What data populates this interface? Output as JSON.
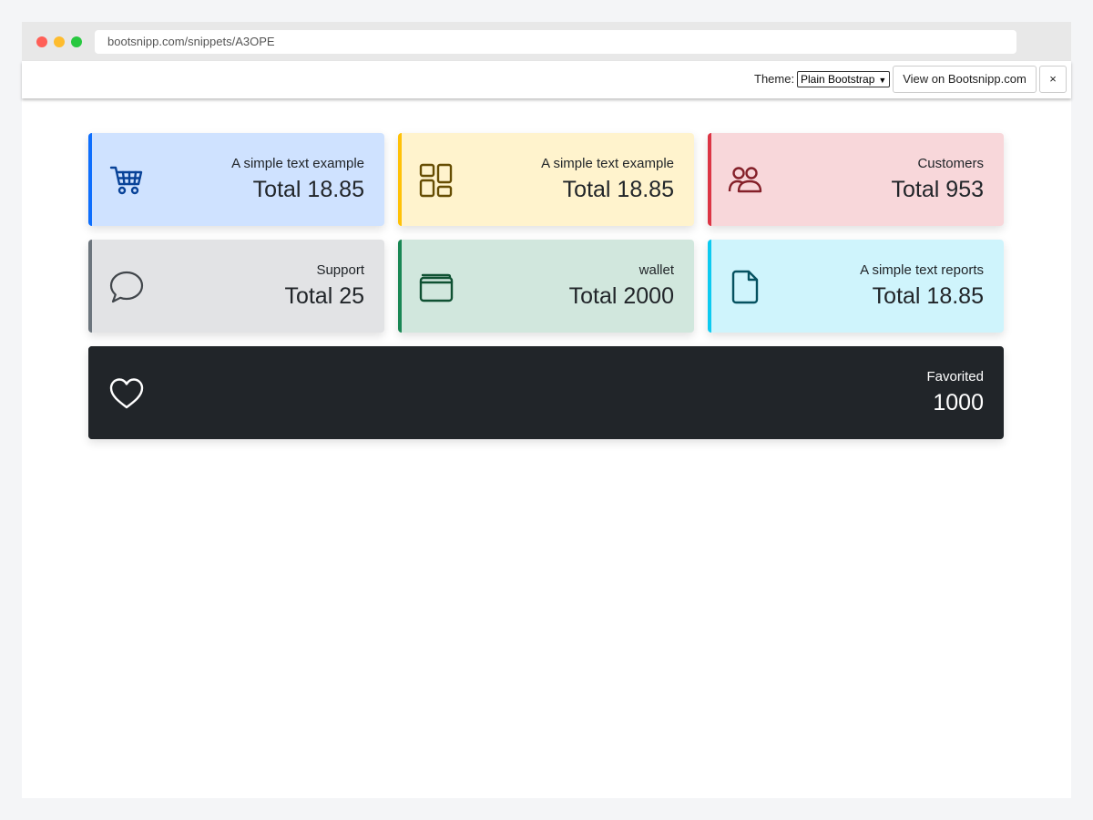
{
  "browser": {
    "url": "bootsnipp.com/snippets/A3OPE"
  },
  "toolbar": {
    "theme_label": "Theme:",
    "theme_selected": "Plain Bootstrap",
    "view_button": "View on Bootsnipp.com",
    "close_button": "×"
  },
  "cards": [
    {
      "label": "A simple text example",
      "value": "Total 18.85",
      "icon": "cart-icon",
      "bg": "#cfe2ff",
      "accent": "#0d6efd",
      "icon_color": "#084298"
    },
    {
      "label": "A simple text example",
      "value": "Total 18.85",
      "icon": "dashboard-icon",
      "bg": "#fff3cd",
      "accent": "#ffc107",
      "icon_color": "#664d03"
    },
    {
      "label": "Customers",
      "value": "Total 953",
      "icon": "people-icon",
      "bg": "#f8d7da",
      "accent": "#dc3545",
      "icon_color": "#842029"
    },
    {
      "label": "Support",
      "value": "Total 25",
      "icon": "chat-icon",
      "bg": "#e2e3e5",
      "accent": "#6c757d",
      "icon_color": "#41464b"
    },
    {
      "label": "wallet",
      "value": "Total 2000",
      "icon": "wallet-icon",
      "bg": "#d1e7dd",
      "accent": "#198754",
      "icon_color": "#0f5132"
    },
    {
      "label": "A simple text reports",
      "value": "Total 18.85",
      "icon": "file-icon",
      "bg": "#cff4fc",
      "accent": "#0dcaf0",
      "icon_color": "#055160"
    },
    {
      "label": "Favorited",
      "value": "1000",
      "icon": "heart-icon",
      "bg": "#212529",
      "accent": "#212529",
      "icon_color": "#ffffff"
    }
  ]
}
